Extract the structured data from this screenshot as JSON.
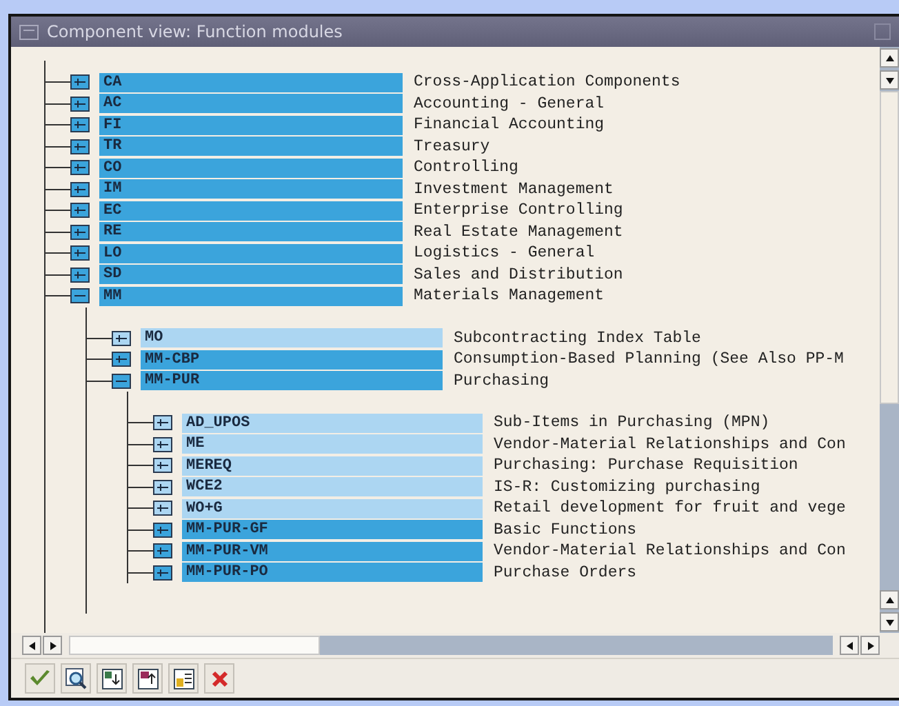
{
  "window": {
    "title": "Component view: Function modules"
  },
  "tree": [
    {
      "key": "CA",
      "description": "Cross-Application Components",
      "selected": true,
      "expanded": false
    },
    {
      "key": "AC",
      "description": "Accounting - General",
      "selected": true,
      "expanded": false
    },
    {
      "key": "FI",
      "description": "Financial Accounting",
      "selected": true,
      "expanded": false
    },
    {
      "key": "TR",
      "description": "Treasury",
      "selected": true,
      "expanded": false
    },
    {
      "key": "CO",
      "description": "Controlling",
      "selected": true,
      "expanded": false
    },
    {
      "key": "IM",
      "description": "Investment Management",
      "selected": true,
      "expanded": false
    },
    {
      "key": "EC",
      "description": "Enterprise Controlling",
      "selected": true,
      "expanded": false
    },
    {
      "key": "RE",
      "description": "Real Estate Management",
      "selected": true,
      "expanded": false
    },
    {
      "key": "LO",
      "description": "Logistics - General",
      "selected": true,
      "expanded": false
    },
    {
      "key": "SD",
      "description": "Sales and Distribution",
      "selected": true,
      "expanded": false
    },
    {
      "key": "MM",
      "description": "Materials Management",
      "selected": true,
      "expanded": true,
      "children": [
        {
          "key": "MO",
          "description": "Subcontracting Index Table",
          "selected": false,
          "expanded": false
        },
        {
          "key": "MM-CBP",
          "description": "Consumption-Based Planning (See Also PP-M",
          "selected": true,
          "expanded": false
        },
        {
          "key": "MM-PUR",
          "description": "Purchasing",
          "selected": true,
          "expanded": true,
          "children": [
            {
              "key": "AD_UPOS",
              "description": "Sub-Items in Purchasing (MPN)",
              "selected": false,
              "expanded": false
            },
            {
              "key": "ME",
              "description": "Vendor-Material Relationships and Con",
              "selected": false,
              "expanded": false
            },
            {
              "key": "MEREQ",
              "description": "Purchasing: Purchase Requisition",
              "selected": false,
              "expanded": false
            },
            {
              "key": "WCE2",
              "description": "IS-R: Customizing purchasing",
              "selected": false,
              "expanded": false
            },
            {
              "key": "WO+G",
              "description": "Retail development for fruit and vege",
              "selected": false,
              "expanded": false
            },
            {
              "key": "MM-PUR-GF",
              "description": "Basic Functions",
              "selected": true,
              "expanded": false
            },
            {
              "key": "MM-PUR-VM",
              "description": "Vendor-Material Relationships and Con",
              "selected": true,
              "expanded": false
            },
            {
              "key": "MM-PUR-PO",
              "description": "Purchase Orders",
              "selected": true,
              "expanded": false
            }
          ]
        }
      ]
    }
  ],
  "toolbar": [
    {
      "kind": "check"
    },
    {
      "kind": "find"
    },
    {
      "kind": "expand"
    },
    {
      "kind": "collapse"
    },
    {
      "kind": "info"
    },
    {
      "kind": "cancel"
    }
  ]
}
